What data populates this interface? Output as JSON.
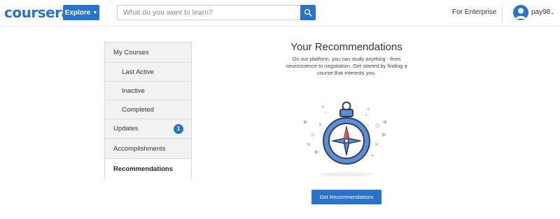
{
  "header": {
    "logo_text": "coursera",
    "explore_label": "Explore",
    "search_placeholder": "What do you want to learn?",
    "enterprise_label": "For Enterprise",
    "username": "pay98",
    "brand_color": "#2a73cc",
    "icons": {
      "explore_chevron": "chevron-down-icon",
      "search": "search-icon",
      "avatar": "user-avatar-icon",
      "user_menu": "chevron-down-icon"
    }
  },
  "sidebar": {
    "items": [
      {
        "label": "My Courses"
      },
      {
        "label": "Last Active"
      },
      {
        "label": "Inactive"
      },
      {
        "label": "Completed"
      },
      {
        "label": "Updates",
        "badge": "1"
      },
      {
        "label": "Accomplishments"
      },
      {
        "label": "Recommendations"
      }
    ]
  },
  "main": {
    "title": "Your Recommendations",
    "description": "On our platform, you can study anything - from neuroscience to negotiation. Get started by finding a course that interests you.",
    "illustration": "compass-icon",
    "cta_label": "Get Recommendations"
  }
}
